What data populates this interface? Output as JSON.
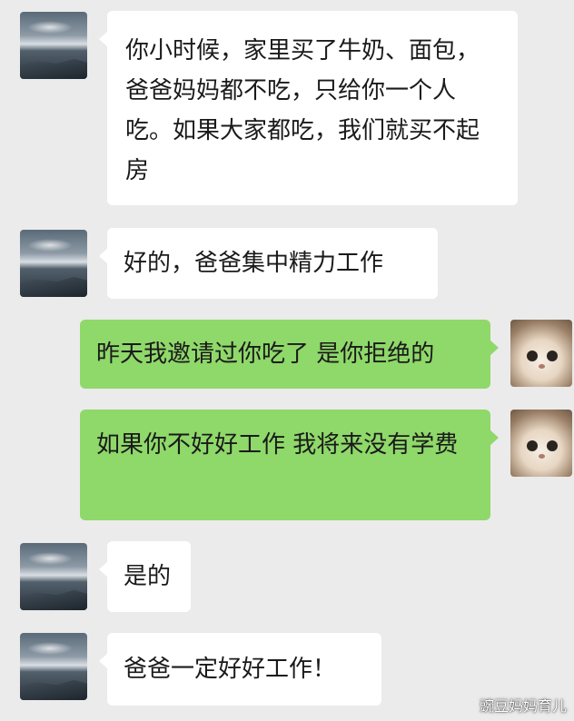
{
  "colors": {
    "background": "#ebebeb",
    "incoming_bubble": "#ffffff",
    "outgoing_bubble": "#8fd86a"
  },
  "messages": [
    {
      "sender": "father",
      "text": "你小时候，家里买了牛奶、面包，爸爸妈妈都不吃，只给你一个人吃。如果大家都吃，我们就买不起房"
    },
    {
      "sender": "father",
      "text": "好的，爸爸集中精力工作"
    },
    {
      "sender": "child",
      "text": "昨天我邀请过你吃了 是你拒绝的"
    },
    {
      "sender": "child",
      "text": "如果你不好好工作 我将来没有学费"
    },
    {
      "sender": "father",
      "text": "是的"
    },
    {
      "sender": "father",
      "text": "爸爸一定好好工作！"
    }
  ],
  "icons": {
    "father_avatar": "landscape-avatar-icon",
    "child_avatar": "kitten-avatar-icon"
  },
  "watermark": "豌豆妈妈育儿"
}
